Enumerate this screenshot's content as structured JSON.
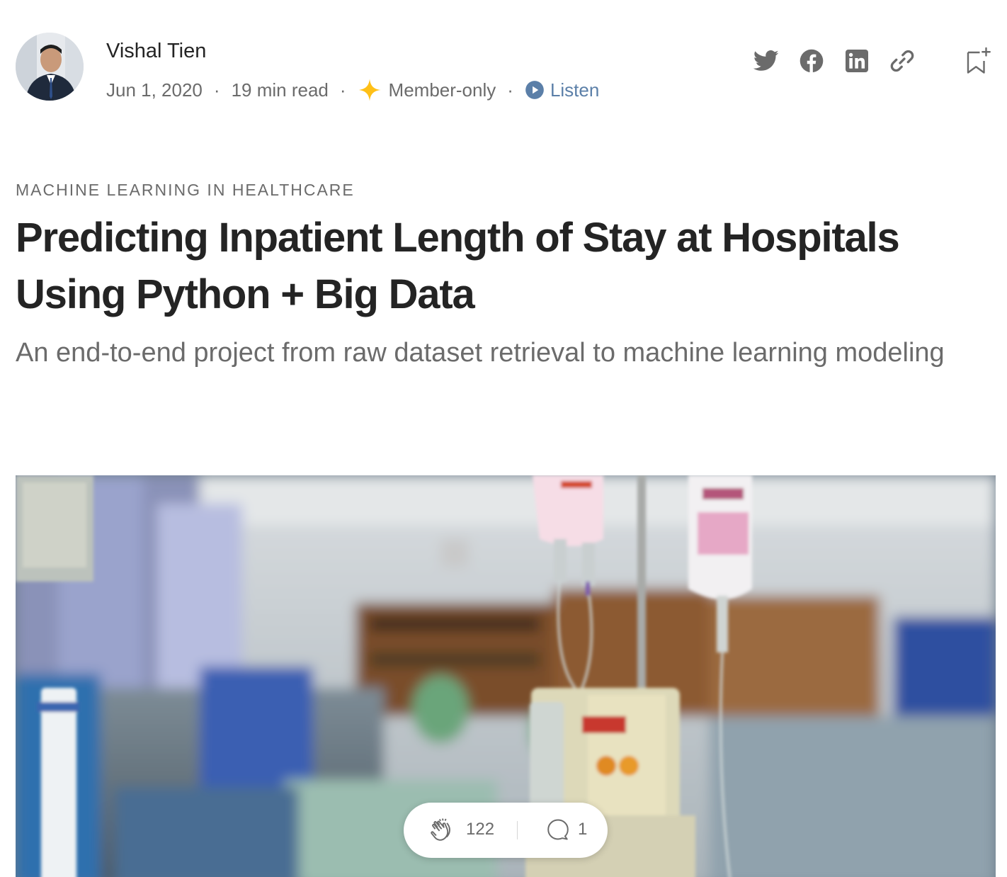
{
  "author": {
    "name": "Vishal Tien",
    "date": "Jun 1, 2020",
    "read_time": "19 min read",
    "membership": "Member-only",
    "listen_label": "Listen"
  },
  "separator": "·",
  "share_icons": [
    "twitter-icon",
    "facebook-icon",
    "linkedin-icon",
    "link-icon",
    "bookmark-add-icon"
  ],
  "article": {
    "kicker": "MACHINE LEARNING IN HEALTHCARE",
    "title": "Predicting Inpatient Length of Stay at Hospitals Using Python + Big Data",
    "subtitle": "An end-to-end project from raw dataset retrieval to machine learning modeling"
  },
  "engagement": {
    "claps": "122",
    "responses": "1"
  },
  "colors": {
    "text_primary": "#242424",
    "text_secondary": "#6b6b6b",
    "member_star": "#ffc017",
    "listen": "#5b7fa8"
  }
}
